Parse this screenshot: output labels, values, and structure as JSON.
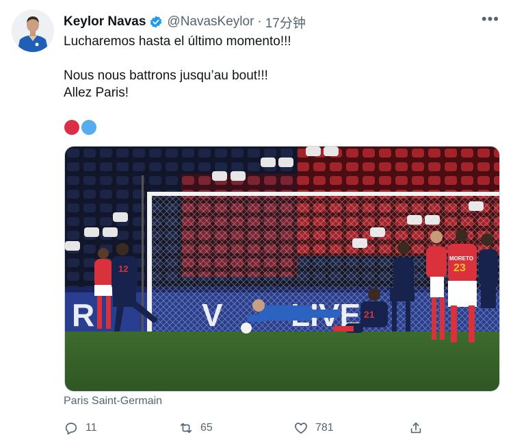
{
  "tweet": {
    "author_name": "Keylor Navas",
    "handle": "@NavasKeylor",
    "separator": "·",
    "timestamp": "17分钟",
    "line1": "Lucharemos hasta el último momento!!!",
    "line2": "Nous nous battrons jusqu’au bout!!!",
    "line3": "Allez Paris!",
    "emoji": [
      "red-circle",
      "blue-circle"
    ],
    "media_caption": "Paris Saint-Germain",
    "colors": {
      "accent": "#1d9bf0",
      "red": "#dc2e47",
      "blue": "#55acee",
      "muted": "#536471"
    }
  },
  "actions": {
    "replies": "11",
    "retweets": "65",
    "likes": "781"
  },
  "photo": {
    "left_player_number": "12",
    "center_player_number": "21",
    "right_player_number": "23",
    "right_player_name": "MORETO"
  }
}
